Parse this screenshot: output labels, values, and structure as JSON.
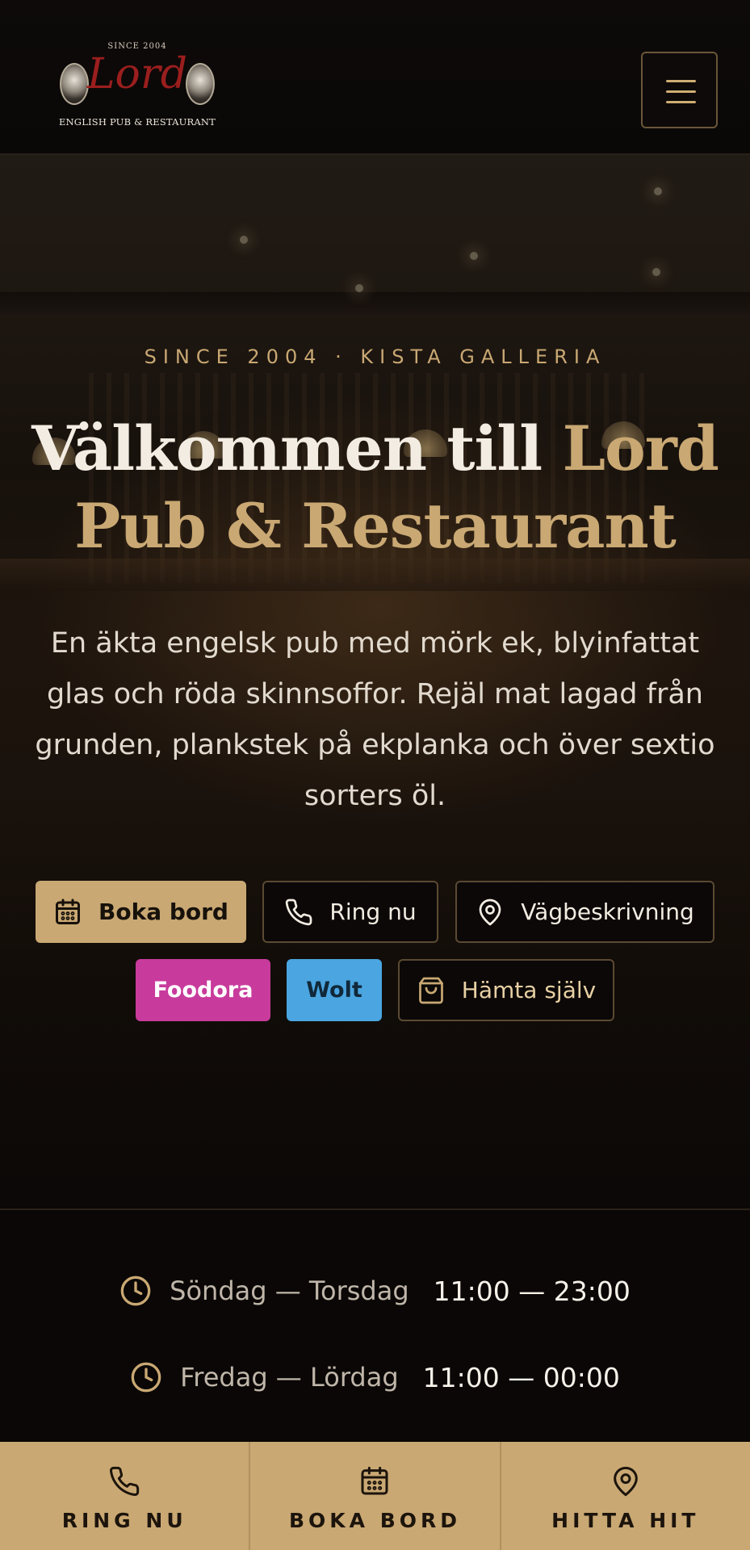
{
  "header": {
    "logo": {
      "since": "SINCE 2004",
      "name": "Lord",
      "tagline": "ENGLISH PUB & RESTAURANT"
    },
    "menu_icon": "hamburger-icon"
  },
  "hero": {
    "eyebrow": "SINCE 2004 · KISTA GALLERIA",
    "title_part1": "Välkommen till ",
    "title_accent": "Lord Pub & Restaurant",
    "intro": "En äkta engelsk pub med mörk ek, blyinfattat glas och röda skinnsoffor. Rejäl mat lagad från grunden, plankstek på ekplanka och över sextio sorters öl.",
    "buttons": {
      "book": {
        "label": "Boka bord",
        "icon": "calendar-icon"
      },
      "call": {
        "label": "Ring nu",
        "icon": "phone-icon"
      },
      "route": {
        "label": "Vägbeskrivning",
        "icon": "map-pin-icon"
      },
      "foodora": {
        "label": "Foodora"
      },
      "wolt": {
        "label": "Wolt"
      },
      "pickup": {
        "label": "Hämta själv",
        "icon": "shopping-bag-icon"
      }
    }
  },
  "hours": [
    {
      "days": "Söndag — Torsdag",
      "time": "11:00 — 23:00",
      "icon": "clock-icon"
    },
    {
      "days": "Fredag — Lördag",
      "time": "11:00 — 00:00",
      "icon": "clock-icon"
    }
  ],
  "bottom_bar": [
    {
      "label": "RING NU",
      "icon": "phone-icon"
    },
    {
      "label": "BOKA BORD",
      "icon": "calendar-icon"
    },
    {
      "label": "HITTA HIT",
      "icon": "map-pin-icon"
    }
  ],
  "colors": {
    "background": "#0c0908",
    "gold": "#c9a873",
    "foodora": "#c83b9c",
    "wolt": "#4aa5e0",
    "logo_red": "#9b1e1e"
  }
}
